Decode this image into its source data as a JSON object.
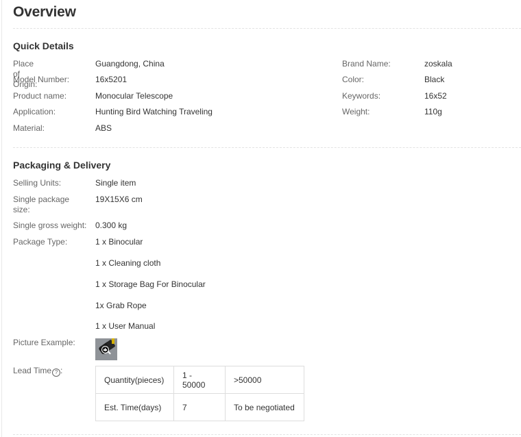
{
  "page": {
    "title": "Overview"
  },
  "quick_details": {
    "heading": "Quick Details",
    "left": [
      {
        "label": "Place of Origin:",
        "value": "Guangdong, China"
      },
      {
        "label": "Model Number:",
        "value": "16x5201"
      },
      {
        "label": "Product name:",
        "value": "Monocular Telescope"
      },
      {
        "label": "Application:",
        "value": "Hunting Bird Watching Traveling"
      },
      {
        "label": "Material:",
        "value": "ABS"
      }
    ],
    "right": [
      {
        "label": "Brand Name:",
        "value": "zoskala"
      },
      {
        "label": "Color:",
        "value": "Black"
      },
      {
        "label": "Keywords:",
        "value": "16x52"
      },
      {
        "label": "Weight:",
        "value": "110g"
      }
    ]
  },
  "packaging": {
    "heading": "Packaging & Delivery",
    "selling_units": {
      "label": "Selling Units:",
      "value": "Single item"
    },
    "package_size": {
      "label_line1": "Single package",
      "label_line2": "size:",
      "value": "19X15X6 cm"
    },
    "gross_weight": {
      "label": "Single gross weight:",
      "value": "0.300 kg"
    },
    "package_type": {
      "label": "Package Type:",
      "items": [
        "1 x Binocular",
        "1 x Cleaning cloth",
        "1 x Storage Bag For Binocular",
        "1x Grab Rope",
        "1 x User Manual"
      ]
    },
    "picture_example": {
      "label": "Picture Example:",
      "icon": "zoom-in-icon"
    },
    "lead_time": {
      "label": "Lead Time",
      "help_glyph": "?",
      "rows": [
        [
          "Quantity(pieces)",
          "1 - 50000",
          ">50000"
        ],
        [
          "Est. Time(days)",
          "7",
          "To be negotiated"
        ]
      ]
    }
  }
}
